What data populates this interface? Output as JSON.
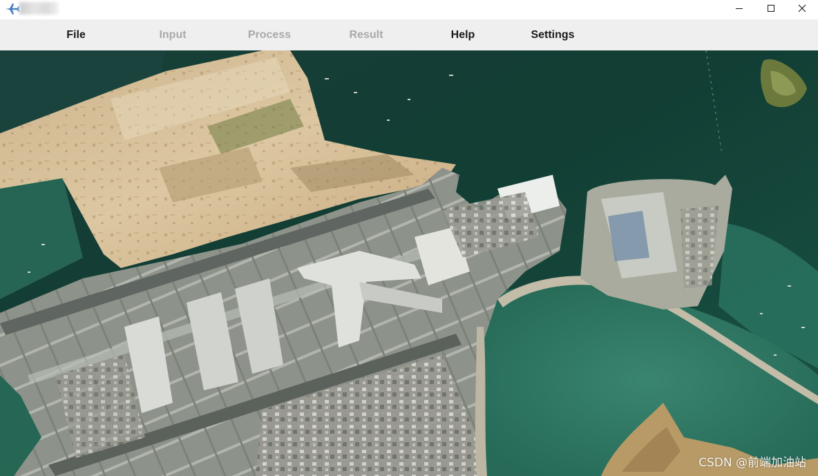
{
  "window": {
    "title": "",
    "app_icon": "airplane-icon",
    "controls": {
      "minimize_icon": "minimize-icon",
      "maximize_icon": "maximize-icon",
      "close_icon": "close-icon"
    }
  },
  "menu": {
    "file": "File",
    "input": "Input",
    "process": "Process",
    "result": "Result",
    "help": "Help",
    "settings": "Settings"
  },
  "menu_state": {
    "input_enabled": false,
    "process_enabled": false,
    "result_enabled": false
  },
  "map": {
    "watermark": "CSDN @前端加油站",
    "colors": {
      "water_dark": "#123f35",
      "water_mid": "#1c5a4a",
      "water_light": "#2f7a66",
      "reclaimed_land": "#d6c09a",
      "airfield": "#8d918a",
      "terminal": "#d9dcd8",
      "vegetation": "#6b7a3c"
    }
  },
  "colors": {
    "titlebar_bg": "#ffffff",
    "menubar_bg": "#efefef",
    "menu_text": "#1a1a1a",
    "menu_disabled_text": "#a9a9a9",
    "app_icon": "#4a7fc1"
  }
}
